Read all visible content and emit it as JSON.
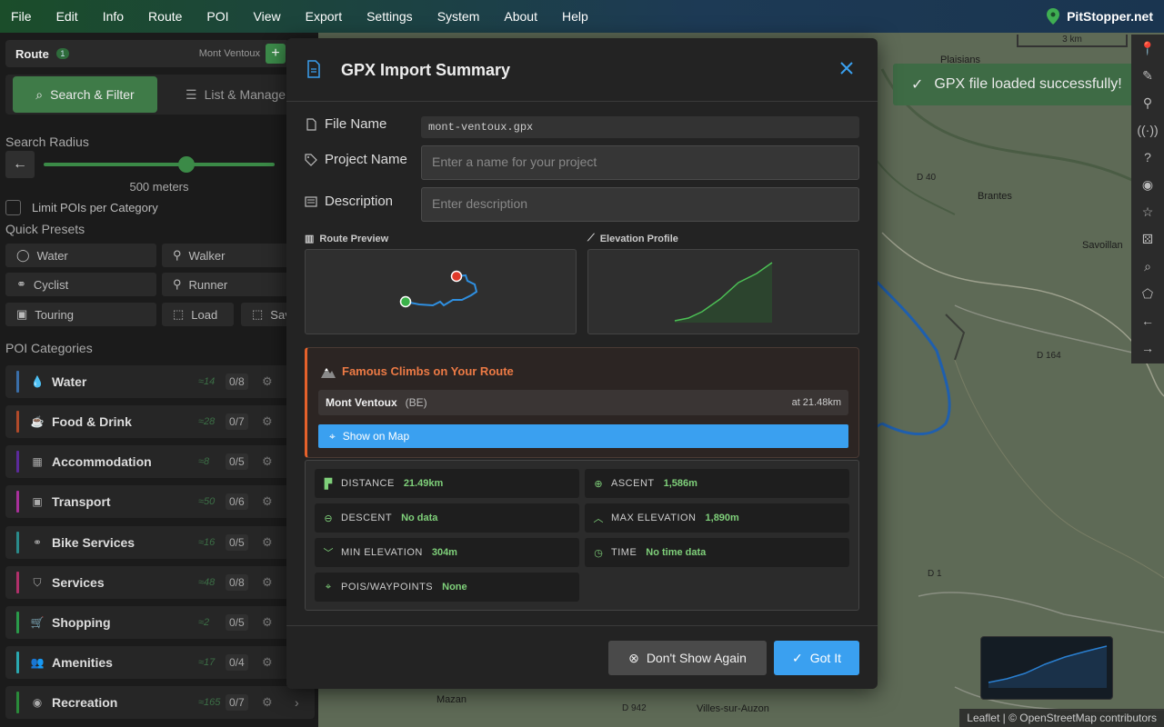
{
  "menubar": {
    "items": [
      "File",
      "Edit",
      "Info",
      "Route",
      "POI",
      "View",
      "Export",
      "Settings",
      "System",
      "About",
      "Help"
    ],
    "brand": "PitStopper.net"
  },
  "map": {
    "scale": "3 km",
    "toast": "GPX file loaded successfully!",
    "attribution": "Leaflet | © OpenStreetMap contributors",
    "towns": [
      "Plaisians",
      "Brantes",
      "Savoillan",
      "Mazan",
      "Villes-sur-Auzon"
    ],
    "roads": [
      "D 40",
      "D 164",
      "D 1",
      "D 942"
    ]
  },
  "sidebar": {
    "route_label": "Route",
    "route_count": "1",
    "route_name": "Mont Ventoux",
    "add_label": "+",
    "tab_search": "Search & Filter",
    "tab_list": "List & Manage",
    "search_radius_label": "Search Radius",
    "radius_fraction": 0.62,
    "radius_value": "500 meters",
    "limit_label": "Limit POIs per Category",
    "quick_presets_label": "Quick Presets",
    "presets": [
      "Water",
      "Walker",
      "Cyclist",
      "Runner",
      "Touring",
      "Load",
      "Save"
    ],
    "poi_categories_label": "POI Categories",
    "categories": [
      {
        "name": "Water",
        "count": "≈14",
        "frac": "0/8",
        "color": "#3a6ea8"
      },
      {
        "name": "Food & Drink",
        "count": "≈28",
        "frac": "0/7",
        "color": "#b04a2a"
      },
      {
        "name": "Accommodation",
        "count": "≈8",
        "frac": "0/5",
        "color": "#5b2a9a"
      },
      {
        "name": "Transport",
        "count": "≈50",
        "frac": "0/6",
        "color": "#a8309a"
      },
      {
        "name": "Bike Services",
        "count": "≈16",
        "frac": "0/5",
        "color": "#2a8a8a"
      },
      {
        "name": "Services",
        "count": "≈48",
        "frac": "0/8",
        "color": "#b0306a"
      },
      {
        "name": "Shopping",
        "count": "≈2",
        "frac": "0/5",
        "color": "#2a9a4a"
      },
      {
        "name": "Amenities",
        "count": "≈17",
        "frac": "0/4",
        "color": "#2aa8b0"
      },
      {
        "name": "Recreation",
        "count": "≈165",
        "frac": "0/7",
        "color": "#2a8a3a"
      }
    ]
  },
  "modal": {
    "title": "GPX Import Summary",
    "file_name_label": "File Name",
    "file_name": "mont-ventoux.gpx",
    "project_name_label": "Project Name",
    "project_placeholder": "Enter a name for your project",
    "description_label": "Description",
    "description_placeholder": "Enter description",
    "route_preview_label": "Route Preview",
    "elevation_profile_label": "Elevation Profile",
    "climbs_title": "Famous Climbs on Your Route",
    "climb_name": "Mont Ventoux",
    "climb_country": "(BE)",
    "climb_at": "at 21.48km",
    "show_on_map": "Show on Map",
    "stats": [
      {
        "label": "DISTANCE",
        "value": "21.49km"
      },
      {
        "label": "ASCENT",
        "value": "1,586m"
      },
      {
        "label": "DESCENT",
        "value": "No data"
      },
      {
        "label": "MAX ELEVATION",
        "value": "1,890m"
      },
      {
        "label": "MIN ELEVATION",
        "value": "304m"
      },
      {
        "label": "TIME",
        "value": "No time data"
      },
      {
        "label": "POIS/WAYPOINTS",
        "value": "None"
      }
    ],
    "dont_show_label": "Don't Show Again",
    "got_it_label": "Got It"
  },
  "colors": {
    "accent_blue": "#3aa0f0",
    "accent_green": "#3f7b48",
    "climb_orange": "#e5612b",
    "stat_value": "#7fd07a"
  }
}
